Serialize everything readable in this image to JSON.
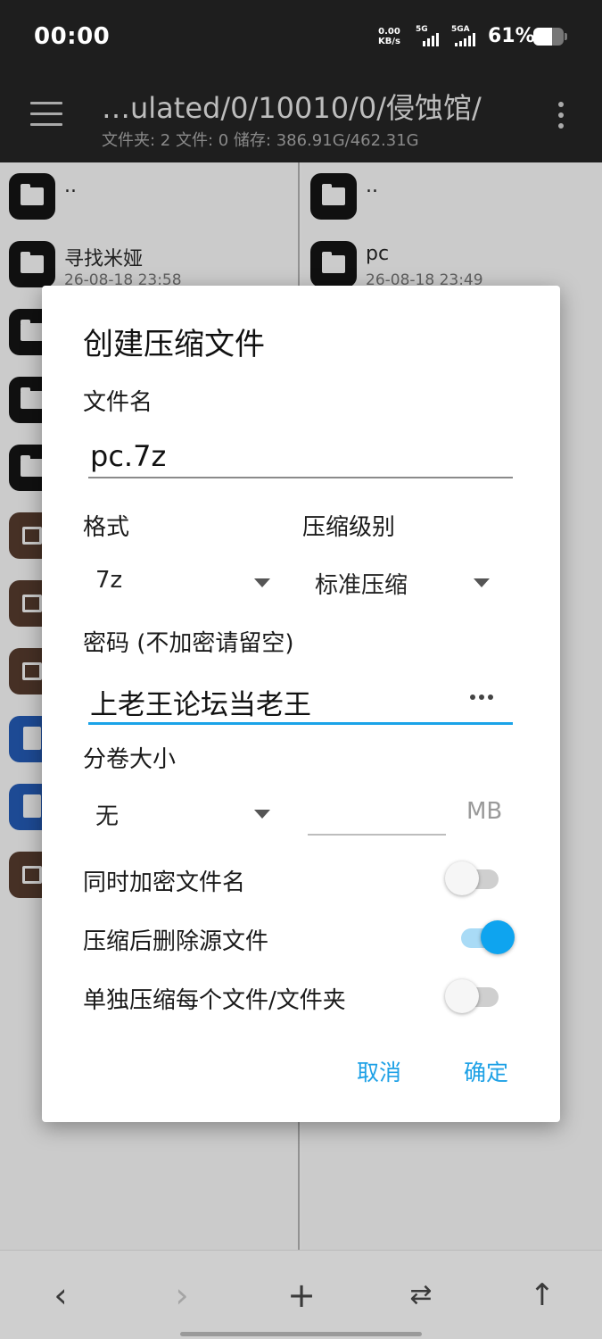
{
  "status_bar": {
    "time": "00:00",
    "net_speed_value": "0.00",
    "net_speed_unit": "KB/s",
    "sim1_label": "5G",
    "sim2_label": "5GA",
    "battery_text": "61%",
    "battery_level": 0.61
  },
  "toolbar": {
    "path": "…ulated/0/10010/0/侵蚀馆/",
    "info": "文件夹: 2  文件: 0  储存: 386.91G/462.31G"
  },
  "left_pane": {
    "items": [
      {
        "name": "..",
        "date": "",
        "type": "folder"
      },
      {
        "name": "寻找米娅",
        "date": "26-08-18 23:58",
        "type": "folder"
      },
      {
        "name": "",
        "date": "",
        "type": "folder"
      },
      {
        "name": "",
        "date": "",
        "type": "folder"
      },
      {
        "name": "",
        "date": "",
        "type": "folder"
      },
      {
        "name": "",
        "date": "",
        "type": "archive"
      },
      {
        "name": "",
        "date": "",
        "type": "archive"
      },
      {
        "name": "",
        "date": "",
        "type": "archive"
      },
      {
        "name": "",
        "date": "",
        "type": "document"
      },
      {
        "name": "",
        "date": "",
        "type": "document"
      },
      {
        "name": "",
        "date": "",
        "type": "archive"
      }
    ]
  },
  "right_pane": {
    "items": [
      {
        "name": "..",
        "date": "",
        "type": "folder"
      },
      {
        "name": "pc",
        "date": "26-08-18 23:49",
        "type": "folder"
      }
    ]
  },
  "dialog": {
    "title": "创建压缩文件",
    "filename_label": "文件名",
    "filename_value": "pc.7z",
    "format_label": "格式",
    "format_value": "7z",
    "level_label": "压缩级别",
    "level_value": "标准压缩",
    "password_label": "密码 (不加密请留空)",
    "password_value": "上老王论坛当老王",
    "split_label": "分卷大小",
    "split_value": "无",
    "split_size_value": "",
    "split_unit": "MB",
    "encrypt_names_label": "同时加密文件名",
    "encrypt_names_on": false,
    "delete_source_label": "压缩后删除源文件",
    "delete_source_on": true,
    "separate_label": "单独压缩每个文件/文件夹",
    "separate_on": false,
    "cancel_label": "取消",
    "ok_label": "确定"
  },
  "bottom_bar": {
    "back_icon": "chevron-left-icon",
    "forward_icon": "chevron-right-icon",
    "add_icon": "plus-icon",
    "swap_icon": "swap-icon",
    "up_icon": "arrow-up-icon"
  },
  "colors": {
    "accent": "#1ea1e6",
    "toolbar_bg": "#1e1e1e"
  }
}
